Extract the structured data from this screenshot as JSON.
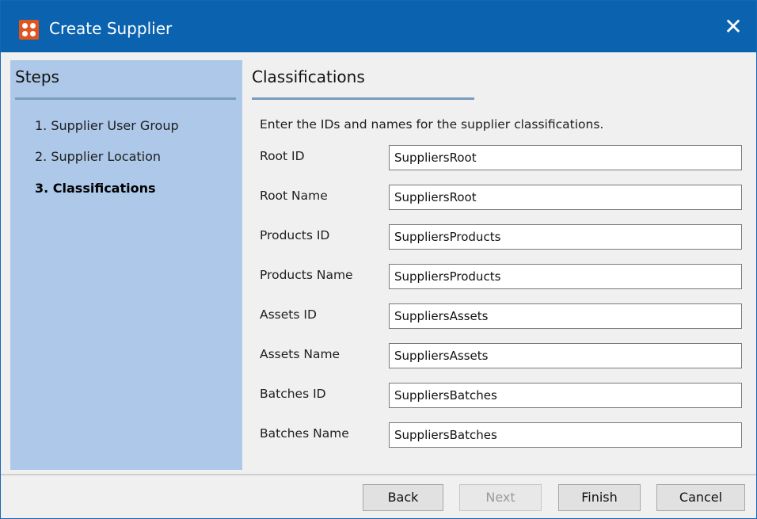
{
  "window": {
    "title": "Create Supplier",
    "close_glyph": "✕",
    "accent_color": "#0b63b0",
    "icon": "app-logo-icon"
  },
  "steps": {
    "title": "Steps",
    "items": [
      {
        "label": "1. Supplier User Group",
        "active": false
      },
      {
        "label": "2. Supplier Location",
        "active": false
      },
      {
        "label": "3. Classifications",
        "active": true
      }
    ]
  },
  "content": {
    "title": "Classifications",
    "instructions": "Enter the IDs and names for the supplier classifications.",
    "fields": [
      {
        "label": "Root ID",
        "value": "SuppliersRoot"
      },
      {
        "label": "Root Name",
        "value": "SuppliersRoot"
      },
      {
        "label": "Products ID",
        "value": "SuppliersProducts"
      },
      {
        "label": "Products Name",
        "value": "SuppliersProducts"
      },
      {
        "label": "Assets ID",
        "value": "SuppliersAssets"
      },
      {
        "label": "Assets Name",
        "value": "SuppliersAssets"
      },
      {
        "label": "Batches ID",
        "value": "SuppliersBatches"
      },
      {
        "label": "Batches Name",
        "value": "SuppliersBatches"
      }
    ]
  },
  "buttons": {
    "back": "Back",
    "next": "Next",
    "finish": "Finish",
    "cancel": "Cancel"
  }
}
